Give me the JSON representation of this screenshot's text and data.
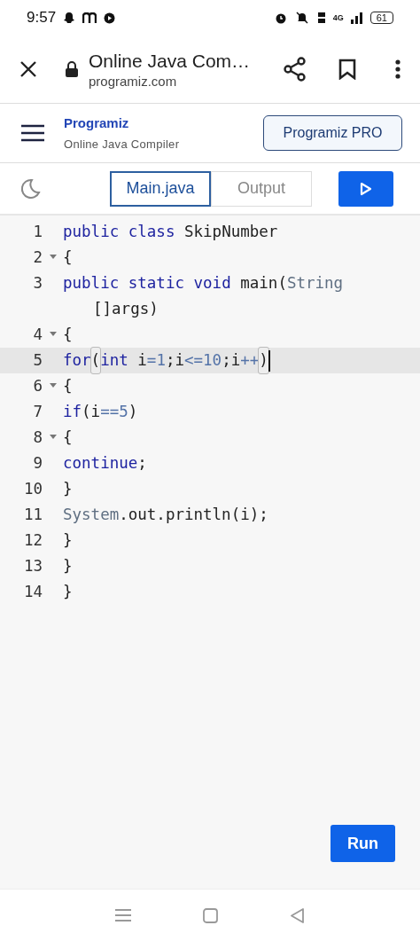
{
  "status_bar": {
    "time": "9:57",
    "battery": "61",
    "network": "4G"
  },
  "browser_bar": {
    "title": "Online Java Com…",
    "url": "programiz.com"
  },
  "header": {
    "logo": "Programiz",
    "subtitle": "Online Java Compiler",
    "pro_button": "Programiz PRO"
  },
  "tabs": [
    {
      "label": "Main.java",
      "selected": true
    },
    {
      "label": "Output",
      "selected": false
    }
  ],
  "editor": {
    "lines": [
      {
        "number": "1",
        "foldable": false,
        "active": false,
        "tokens": [
          {
            "text": "public ",
            "kind": "kw"
          },
          {
            "text": "class ",
            "kind": "kw"
          },
          {
            "text": "SkipNumber",
            "kind": "plain"
          }
        ]
      },
      {
        "number": "2",
        "foldable": true,
        "active": false,
        "tokens": [
          {
            "text": "{",
            "kind": "plain"
          }
        ]
      },
      {
        "number": "3",
        "foldable": false,
        "active": false,
        "tokens": [
          {
            "text": "public ",
            "kind": "kw"
          },
          {
            "text": "static ",
            "kind": "kw"
          },
          {
            "text": "void ",
            "kind": "kw"
          },
          {
            "text": "main",
            "kind": "plain"
          },
          {
            "text": "(",
            "kind": "plain"
          },
          {
            "text": "String",
            "kind": "type"
          },
          {
            "text": "[]args)",
            "kind": "plain"
          }
        ]
      },
      {
        "number": "4",
        "foldable": true,
        "active": false,
        "tokens": [
          {
            "text": "{",
            "kind": "plain"
          }
        ]
      },
      {
        "number": "5",
        "foldable": false,
        "active": true,
        "tokens": [
          {
            "text": "for",
            "kind": "kw"
          },
          {
            "text": "(",
            "kind": "match"
          },
          {
            "text": "int ",
            "kind": "kw"
          },
          {
            "text": "i",
            "kind": "plain"
          },
          {
            "text": "=1",
            "kind": "lit"
          },
          {
            "text": ";i",
            "kind": "plain"
          },
          {
            "text": "<=10",
            "kind": "lit"
          },
          {
            "text": ";i",
            "kind": "plain"
          },
          {
            "text": "++",
            "kind": "lit"
          },
          {
            "text": ")",
            "kind": "match"
          }
        ]
      },
      {
        "number": "6",
        "foldable": true,
        "active": false,
        "tokens": [
          {
            "text": "{",
            "kind": "plain"
          }
        ]
      },
      {
        "number": "7",
        "foldable": false,
        "active": false,
        "tokens": [
          {
            "text": "if",
            "kind": "kw"
          },
          {
            "text": "(i",
            "kind": "plain"
          },
          {
            "text": "==5",
            "kind": "lit"
          },
          {
            "text": ")",
            "kind": "plain"
          }
        ]
      },
      {
        "number": "8",
        "foldable": true,
        "active": false,
        "tokens": [
          {
            "text": "{",
            "kind": "plain"
          }
        ]
      },
      {
        "number": "9",
        "foldable": false,
        "active": false,
        "tokens": [
          {
            "text": "continue",
            "kind": "kw"
          },
          {
            "text": ";",
            "kind": "plain"
          }
        ]
      },
      {
        "number": "10",
        "foldable": false,
        "active": false,
        "tokens": [
          {
            "text": "}",
            "kind": "plain"
          }
        ]
      },
      {
        "number": "11",
        "foldable": false,
        "active": false,
        "tokens": [
          {
            "text": "System",
            "kind": "type"
          },
          {
            "text": ".out.println(i);",
            "kind": "plain"
          }
        ]
      },
      {
        "number": "12",
        "foldable": false,
        "active": false,
        "tokens": [
          {
            "text": "}",
            "kind": "plain"
          }
        ]
      },
      {
        "number": "13",
        "foldable": false,
        "active": false,
        "tokens": [
          {
            "text": "}",
            "kind": "plain"
          }
        ]
      },
      {
        "number": "14",
        "foldable": false,
        "active": false,
        "tokens": [
          {
            "text": "}",
            "kind": "plain"
          }
        ]
      }
    ]
  },
  "run_button": "Run"
}
